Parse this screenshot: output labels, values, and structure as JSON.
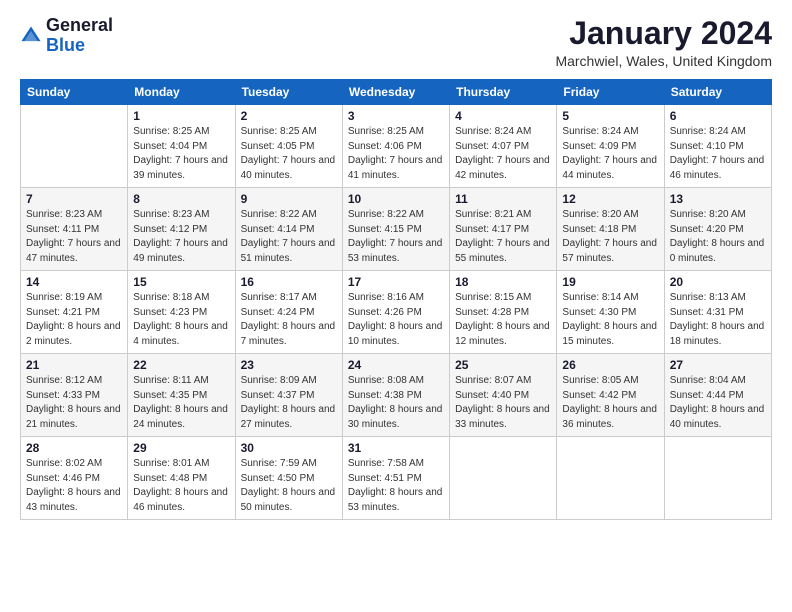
{
  "logo": {
    "general": "General",
    "blue": "Blue"
  },
  "header": {
    "month_year": "January 2024",
    "location": "Marchwiel, Wales, United Kingdom"
  },
  "weekdays": [
    "Sunday",
    "Monday",
    "Tuesday",
    "Wednesday",
    "Thursday",
    "Friday",
    "Saturday"
  ],
  "weeks": [
    [
      {
        "day": "",
        "sunrise": "",
        "sunset": "",
        "daylight": ""
      },
      {
        "day": "1",
        "sunrise": "Sunrise: 8:25 AM",
        "sunset": "Sunset: 4:04 PM",
        "daylight": "Daylight: 7 hours and 39 minutes."
      },
      {
        "day": "2",
        "sunrise": "Sunrise: 8:25 AM",
        "sunset": "Sunset: 4:05 PM",
        "daylight": "Daylight: 7 hours and 40 minutes."
      },
      {
        "day": "3",
        "sunrise": "Sunrise: 8:25 AM",
        "sunset": "Sunset: 4:06 PM",
        "daylight": "Daylight: 7 hours and 41 minutes."
      },
      {
        "day": "4",
        "sunrise": "Sunrise: 8:24 AM",
        "sunset": "Sunset: 4:07 PM",
        "daylight": "Daylight: 7 hours and 42 minutes."
      },
      {
        "day": "5",
        "sunrise": "Sunrise: 8:24 AM",
        "sunset": "Sunset: 4:09 PM",
        "daylight": "Daylight: 7 hours and 44 minutes."
      },
      {
        "day": "6",
        "sunrise": "Sunrise: 8:24 AM",
        "sunset": "Sunset: 4:10 PM",
        "daylight": "Daylight: 7 hours and 46 minutes."
      }
    ],
    [
      {
        "day": "7",
        "sunrise": "Sunrise: 8:23 AM",
        "sunset": "Sunset: 4:11 PM",
        "daylight": "Daylight: 7 hours and 47 minutes."
      },
      {
        "day": "8",
        "sunrise": "Sunrise: 8:23 AM",
        "sunset": "Sunset: 4:12 PM",
        "daylight": "Daylight: 7 hours and 49 minutes."
      },
      {
        "day": "9",
        "sunrise": "Sunrise: 8:22 AM",
        "sunset": "Sunset: 4:14 PM",
        "daylight": "Daylight: 7 hours and 51 minutes."
      },
      {
        "day": "10",
        "sunrise": "Sunrise: 8:22 AM",
        "sunset": "Sunset: 4:15 PM",
        "daylight": "Daylight: 7 hours and 53 minutes."
      },
      {
        "day": "11",
        "sunrise": "Sunrise: 8:21 AM",
        "sunset": "Sunset: 4:17 PM",
        "daylight": "Daylight: 7 hours and 55 minutes."
      },
      {
        "day": "12",
        "sunrise": "Sunrise: 8:20 AM",
        "sunset": "Sunset: 4:18 PM",
        "daylight": "Daylight: 7 hours and 57 minutes."
      },
      {
        "day": "13",
        "sunrise": "Sunrise: 8:20 AM",
        "sunset": "Sunset: 4:20 PM",
        "daylight": "Daylight: 8 hours and 0 minutes."
      }
    ],
    [
      {
        "day": "14",
        "sunrise": "Sunrise: 8:19 AM",
        "sunset": "Sunset: 4:21 PM",
        "daylight": "Daylight: 8 hours and 2 minutes."
      },
      {
        "day": "15",
        "sunrise": "Sunrise: 8:18 AM",
        "sunset": "Sunset: 4:23 PM",
        "daylight": "Daylight: 8 hours and 4 minutes."
      },
      {
        "day": "16",
        "sunrise": "Sunrise: 8:17 AM",
        "sunset": "Sunset: 4:24 PM",
        "daylight": "Daylight: 8 hours and 7 minutes."
      },
      {
        "day": "17",
        "sunrise": "Sunrise: 8:16 AM",
        "sunset": "Sunset: 4:26 PM",
        "daylight": "Daylight: 8 hours and 10 minutes."
      },
      {
        "day": "18",
        "sunrise": "Sunrise: 8:15 AM",
        "sunset": "Sunset: 4:28 PM",
        "daylight": "Daylight: 8 hours and 12 minutes."
      },
      {
        "day": "19",
        "sunrise": "Sunrise: 8:14 AM",
        "sunset": "Sunset: 4:30 PM",
        "daylight": "Daylight: 8 hours and 15 minutes."
      },
      {
        "day": "20",
        "sunrise": "Sunrise: 8:13 AM",
        "sunset": "Sunset: 4:31 PM",
        "daylight": "Daylight: 8 hours and 18 minutes."
      }
    ],
    [
      {
        "day": "21",
        "sunrise": "Sunrise: 8:12 AM",
        "sunset": "Sunset: 4:33 PM",
        "daylight": "Daylight: 8 hours and 21 minutes."
      },
      {
        "day": "22",
        "sunrise": "Sunrise: 8:11 AM",
        "sunset": "Sunset: 4:35 PM",
        "daylight": "Daylight: 8 hours and 24 minutes."
      },
      {
        "day": "23",
        "sunrise": "Sunrise: 8:09 AM",
        "sunset": "Sunset: 4:37 PM",
        "daylight": "Daylight: 8 hours and 27 minutes."
      },
      {
        "day": "24",
        "sunrise": "Sunrise: 8:08 AM",
        "sunset": "Sunset: 4:38 PM",
        "daylight": "Daylight: 8 hours and 30 minutes."
      },
      {
        "day": "25",
        "sunrise": "Sunrise: 8:07 AM",
        "sunset": "Sunset: 4:40 PM",
        "daylight": "Daylight: 8 hours and 33 minutes."
      },
      {
        "day": "26",
        "sunrise": "Sunrise: 8:05 AM",
        "sunset": "Sunset: 4:42 PM",
        "daylight": "Daylight: 8 hours and 36 minutes."
      },
      {
        "day": "27",
        "sunrise": "Sunrise: 8:04 AM",
        "sunset": "Sunset: 4:44 PM",
        "daylight": "Daylight: 8 hours and 40 minutes."
      }
    ],
    [
      {
        "day": "28",
        "sunrise": "Sunrise: 8:02 AM",
        "sunset": "Sunset: 4:46 PM",
        "daylight": "Daylight: 8 hours and 43 minutes."
      },
      {
        "day": "29",
        "sunrise": "Sunrise: 8:01 AM",
        "sunset": "Sunset: 4:48 PM",
        "daylight": "Daylight: 8 hours and 46 minutes."
      },
      {
        "day": "30",
        "sunrise": "Sunrise: 7:59 AM",
        "sunset": "Sunset: 4:50 PM",
        "daylight": "Daylight: 8 hours and 50 minutes."
      },
      {
        "day": "31",
        "sunrise": "Sunrise: 7:58 AM",
        "sunset": "Sunset: 4:51 PM",
        "daylight": "Daylight: 8 hours and 53 minutes."
      },
      {
        "day": "",
        "sunrise": "",
        "sunset": "",
        "daylight": ""
      },
      {
        "day": "",
        "sunrise": "",
        "sunset": "",
        "daylight": ""
      },
      {
        "day": "",
        "sunrise": "",
        "sunset": "",
        "daylight": ""
      }
    ]
  ]
}
